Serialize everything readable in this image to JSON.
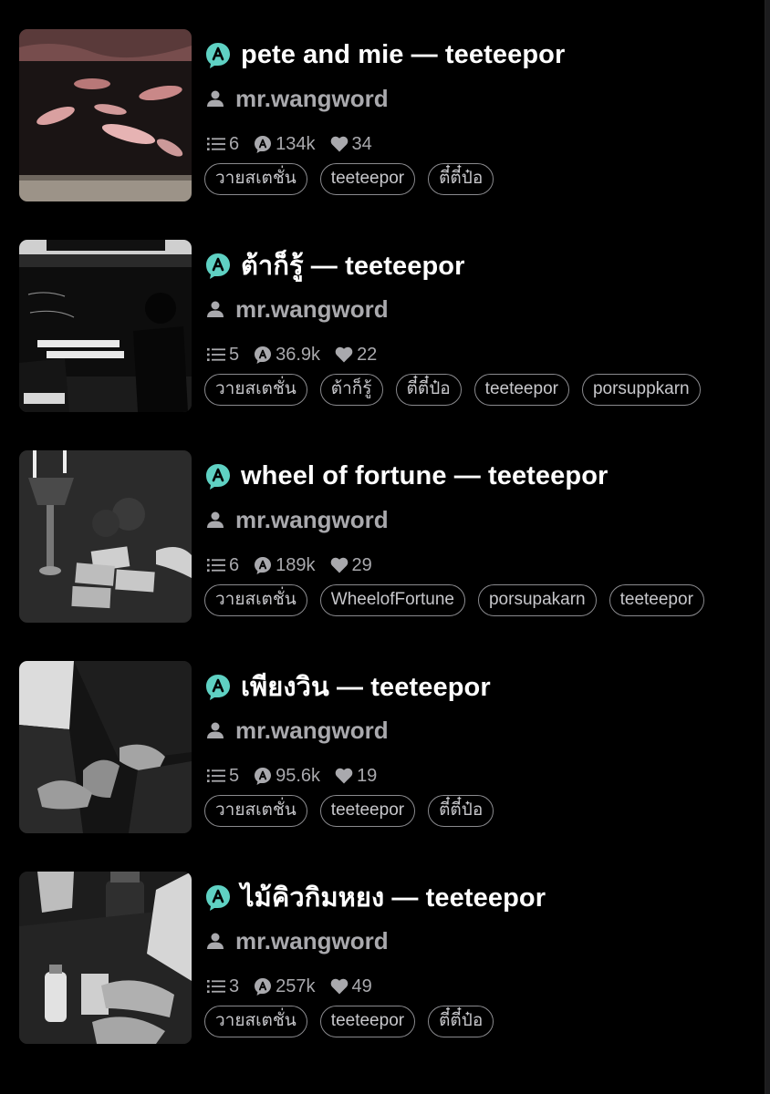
{
  "brand_color": "#5fd1c3",
  "icons": {
    "badge": "circle-a-badge-icon",
    "author": "person-icon",
    "parts": "list-icon",
    "reads": "reads-bubble-icon",
    "votes": "heart-icon"
  },
  "stories": [
    {
      "title": "pete and mie — teeteepor",
      "author": "mr.wangword",
      "parts": "6",
      "reads": "134k",
      "votes": "34",
      "tags": [
        "วายสเตชั่น",
        "teeteepor",
        "ตี๋ตี๋ป๋อ"
      ]
    },
    {
      "title": "ต้าก็รู้ — teeteepor",
      "author": "mr.wangword",
      "parts": "5",
      "reads": "36.9k",
      "votes": "22",
      "tags": [
        "วายสเตชั่น",
        "ต้าก็รู้",
        "ตี๋ตี๋ป๋อ",
        "teeteepor",
        "porsuppkarn"
      ]
    },
    {
      "title": "wheel of fortune — teeteepor",
      "author": "mr.wangword",
      "parts": "6",
      "reads": "189k",
      "votes": "29",
      "tags": [
        "วายสเตชั่น",
        "WheelofFortune",
        "porsupakarn",
        "teeteepor"
      ]
    },
    {
      "title": "เพียงวิน — teeteepor",
      "author": "mr.wangword",
      "parts": "5",
      "reads": "95.6k",
      "votes": "19",
      "tags": [
        "วายสเตชั่น",
        "teeteepor",
        "ตี๋ตี๋ป๋อ"
      ]
    },
    {
      "title": "ไม้คิวกิมหยง — teeteepor",
      "author": "mr.wangword",
      "parts": "3",
      "reads": "257k",
      "votes": "49",
      "tags": [
        "วายสเตชั่น",
        "teeteepor",
        "ตี๋ตี๋ป๋อ"
      ]
    }
  ]
}
